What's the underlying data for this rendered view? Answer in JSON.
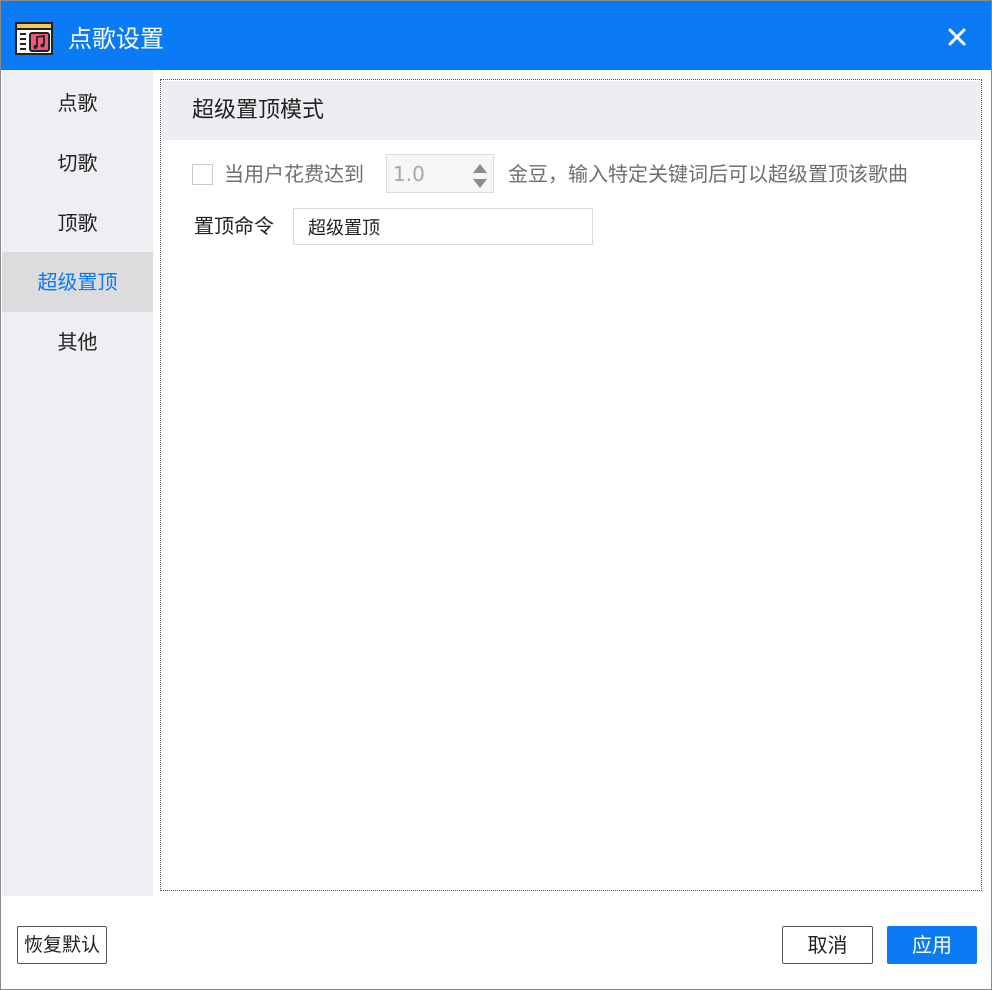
{
  "window": {
    "title": "点歌设置",
    "app_icon": "music-window-icon",
    "close_icon": "close-icon"
  },
  "sidebar": {
    "items": [
      {
        "label": "点歌",
        "active": false
      },
      {
        "label": "切歌",
        "active": false
      },
      {
        "label": "顶歌",
        "active": false
      },
      {
        "label": "超级置顶",
        "active": true
      },
      {
        "label": "其他",
        "active": false
      }
    ]
  },
  "section": {
    "title": "超级置顶模式",
    "condition": {
      "checked": false,
      "prefix": "当用户花费达到",
      "amount": "1.0",
      "suffix": "金豆，输入特定关键词后可以超级置顶该歌曲"
    },
    "command": {
      "label": "置顶命令",
      "value": "超级置顶"
    }
  },
  "footer": {
    "restore_label": "恢复默认",
    "cancel_label": "取消",
    "apply_label": "应用"
  },
  "colors": {
    "accent": "#0a7af5",
    "sidebar_bg": "#efeff3",
    "sidebar_active_bg": "#dcdcde",
    "header_bg": "#eeeef2"
  }
}
